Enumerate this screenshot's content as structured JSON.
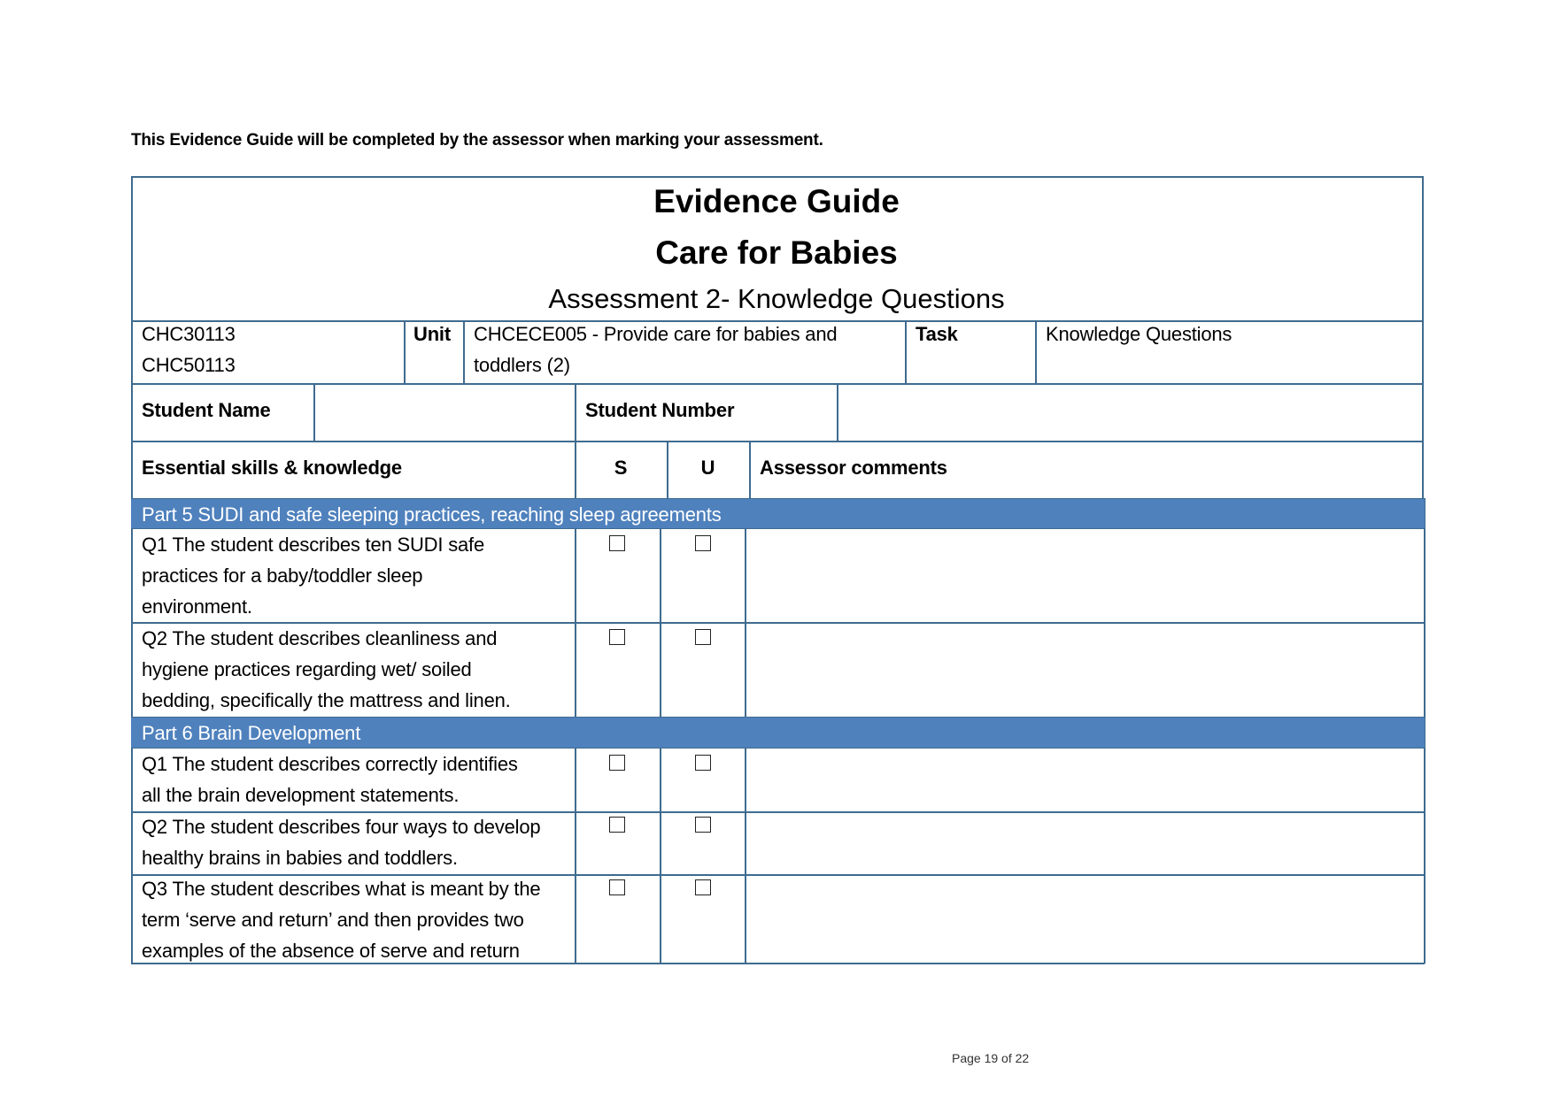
{
  "intro_text": "This Evidence Guide will be completed by the assessor when marking your assessment.",
  "title": {
    "line1": "Evidence Guide",
    "line2": "Care for Babies",
    "line3": "Assessment 2- Knowledge Questions"
  },
  "info_row": {
    "qualifications": [
      "CHC30113",
      "CHC50113"
    ],
    "unit_label": "Unit",
    "unit_value_line1": "CHCECE005 - Provide care for babies and",
    "unit_value_line2": "toddlers (2)",
    "task_label": "Task",
    "task_value": "Knowledge Questions"
  },
  "student_row": {
    "name_label": "Student Name",
    "name_value": "",
    "number_label": "Student Number",
    "number_value": ""
  },
  "header_row": {
    "skills_label": "Essential skills & knowledge",
    "s_label": "S",
    "u_label": "U",
    "comments_label": "Assessor comments"
  },
  "sections": [
    {
      "title": "Part 5 SUDI and safe sleeping practices, reaching sleep agreements",
      "questions": [
        {
          "lines": [
            "Q1 The student describes ten SUDI safe",
            "practices for a baby/toddler sleep",
            "environment."
          ],
          "s_checked": false,
          "u_checked": false,
          "comment": ""
        },
        {
          "lines": [
            "Q2 The student describes cleanliness and",
            "hygiene practices regarding wet/ soiled",
            "bedding, specifically the mattress and linen."
          ],
          "s_checked": false,
          "u_checked": false,
          "comment": ""
        }
      ]
    },
    {
      "title": "Part 6 Brain Development",
      "questions": [
        {
          "lines": [
            "Q1 The student describes correctly identifies",
            "all the brain development statements."
          ],
          "s_checked": false,
          "u_checked": false,
          "comment": ""
        },
        {
          "lines": [
            "Q2 The student describes four ways to develop",
            "healthy brains in babies and toddlers."
          ],
          "s_checked": false,
          "u_checked": false,
          "comment": ""
        },
        {
          "lines": [
            "Q3 The student describes what is meant by the",
            "term ‘serve and return’ and then provides two",
            "examples of the absence of serve and return"
          ],
          "s_checked": false,
          "u_checked": false,
          "comment": ""
        }
      ]
    }
  ],
  "footer": {
    "page_label": "Page 19 of 22"
  },
  "colors": {
    "border": "#3f6b8f",
    "section_band": "#4f81bd",
    "section_text": "#ffffff"
  }
}
